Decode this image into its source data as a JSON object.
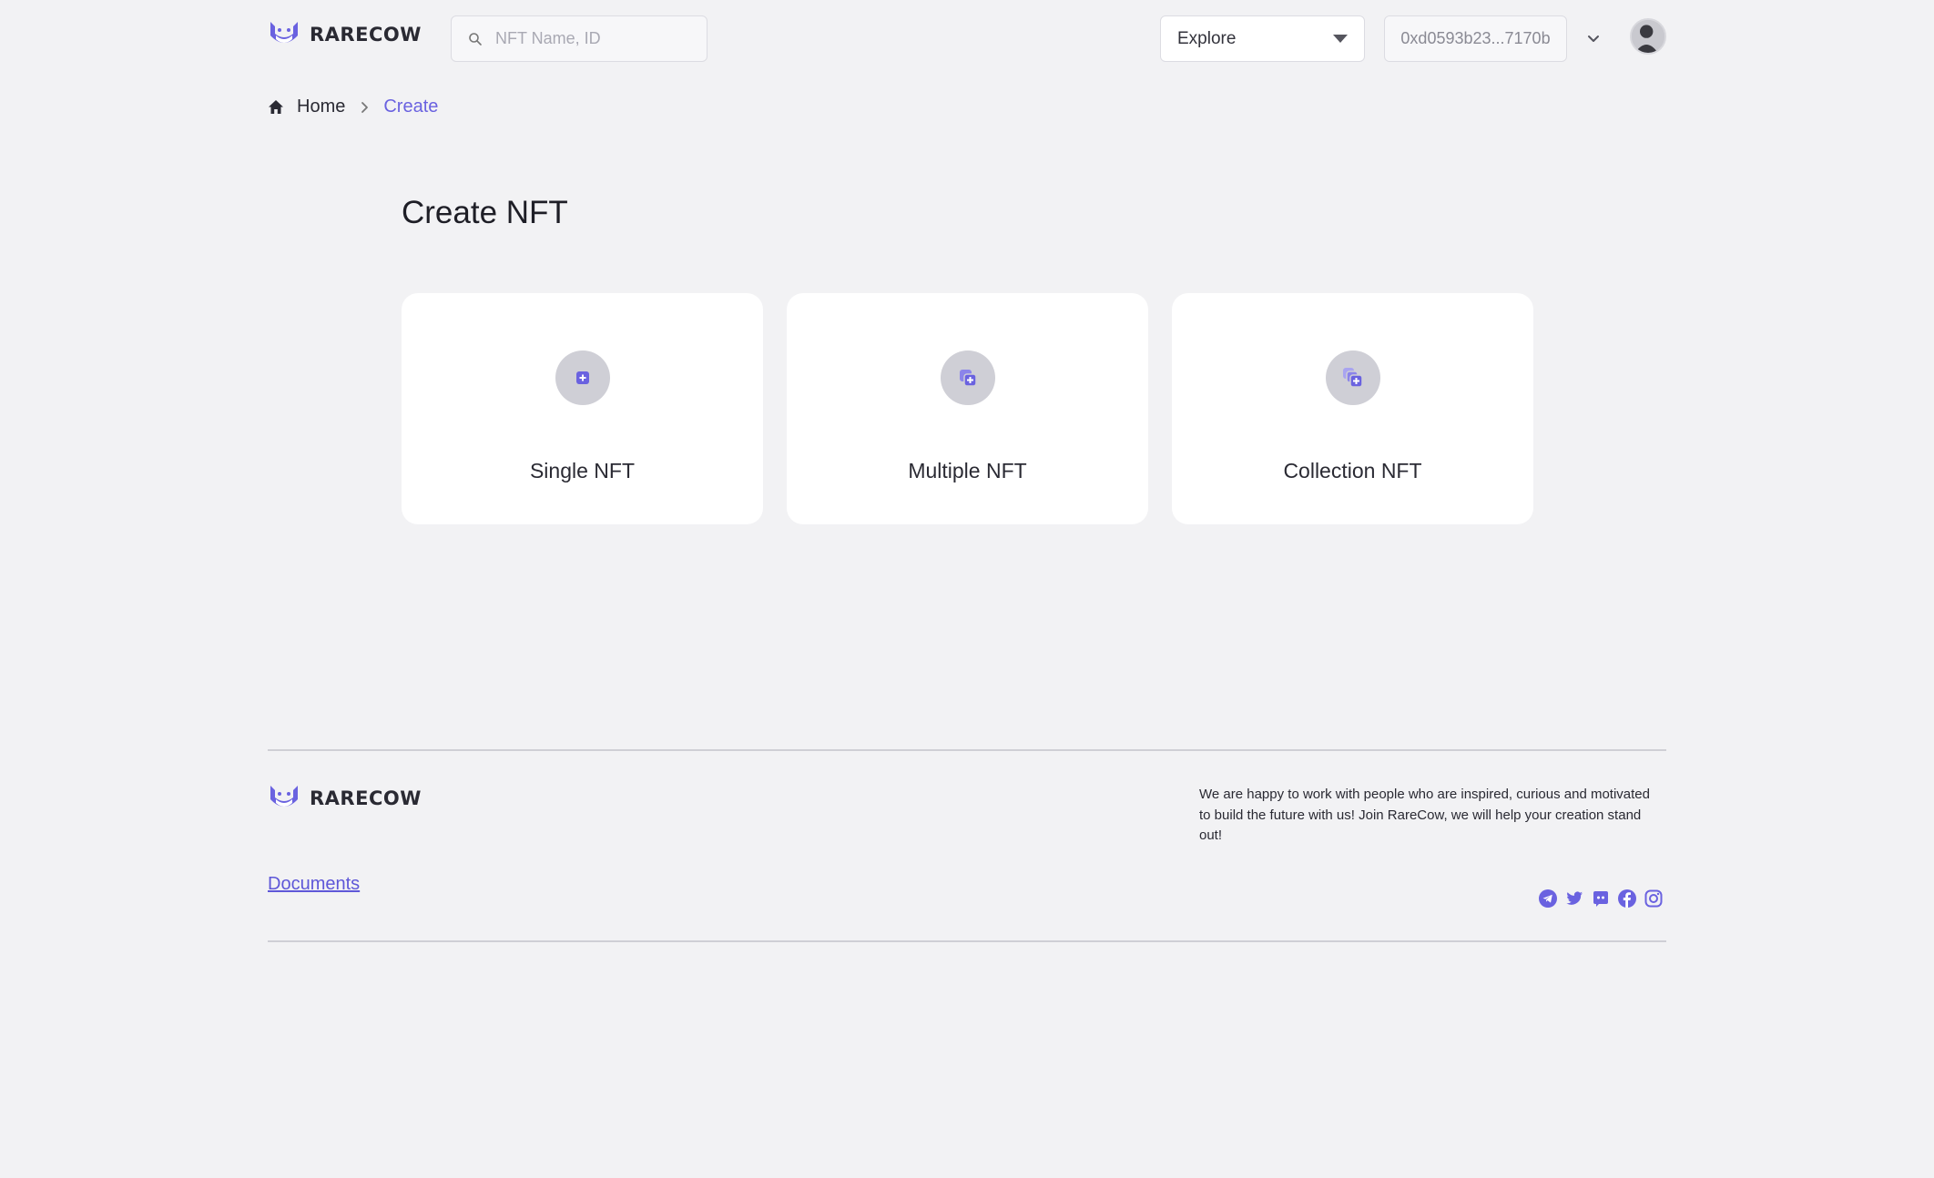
{
  "brand": {
    "name": "RARECOW",
    "accent": "#6a62e0"
  },
  "search": {
    "placeholder": "NFT Name, ID"
  },
  "nav": {
    "explore_label": "Explore"
  },
  "wallet": {
    "address": "0xd0593b23...7170b"
  },
  "breadcrumb": {
    "home": "Home",
    "current": "Create"
  },
  "page": {
    "title": "Create NFT"
  },
  "cards": [
    {
      "label": "Single NFT",
      "icon": "add-square-icon"
    },
    {
      "label": "Multiple NFT",
      "icon": "add-copy-icon"
    },
    {
      "label": "Collection NFT",
      "icon": "add-collection-icon"
    }
  ],
  "footer": {
    "brand": "RARECOW",
    "documents_link": "Documents",
    "tagline": "We are happy to work with people who are inspired, curious and motivated to build the future with us! Join RareCow, we will help your creation stand out!",
    "socials": [
      "telegram-icon",
      "twitter-icon",
      "discord-icon",
      "facebook-icon",
      "instagram-icon"
    ]
  }
}
